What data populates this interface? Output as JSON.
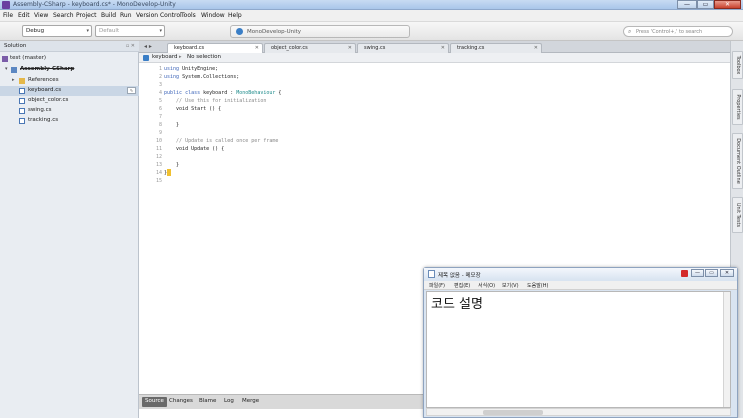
{
  "window": {
    "title": "Assembly-CSharp - keyboard.cs* - MonoDevelop-Unity",
    "minimize": "—",
    "maximize": "▭",
    "close": "✕"
  },
  "menu": [
    "File",
    "Edit",
    "View",
    "Search",
    "Project",
    "Build",
    "Run",
    "Version Control",
    "Tools",
    "Window",
    "Help"
  ],
  "toolbar": {
    "config": "Debug",
    "platform": "Default",
    "status": "MonoDevelop-Unity",
    "search_placeholder": "Press 'Control+,' to search"
  },
  "solution": {
    "title": "Solution",
    "controls": "▫ ✕",
    "items": [
      {
        "label": "test (master)"
      },
      {
        "label": "Assembly-CSharp"
      },
      {
        "label": "References"
      },
      {
        "label": "keyboard.cs",
        "badge": "✎"
      },
      {
        "label": "object_color.cs"
      },
      {
        "label": "swing.cs"
      },
      {
        "label": "tracking.cs"
      }
    ]
  },
  "tabs": {
    "nav": "◂ ▸",
    "items": [
      "keyboard.cs",
      "object_color.cs",
      "swing.cs",
      "tracking.cs"
    ],
    "close": "✕"
  },
  "path": {
    "file": "keyboard",
    "sep": "▸",
    "member": "No selection"
  },
  "code": {
    "line_numbers": [
      "1",
      "2",
      "3",
      "4",
      "5",
      "6",
      "7",
      "8",
      "9",
      "10",
      "11",
      "12",
      "13",
      "14",
      "15"
    ],
    "l1_kw": "using",
    "l1_rest": " UnityEngine;",
    "l2_kw": "using",
    "l2_rest": " System.Collections;",
    "l4_kw": "public class",
    "l4_name": " keyboard : ",
    "l4_type": "MonoBehaviour",
    "l4_end": " {",
    "l5": "    // Use this for initialization",
    "l6": "    void Start () {",
    "l8": "    }",
    "l10": "    // Update is called once per frame",
    "l11": "    void Update () {",
    "l13": "    }",
    "l14": "}"
  },
  "bottom_tabs": [
    "Source",
    "Changes",
    "Blame",
    "Log",
    "Merge"
  ],
  "dock": [
    "Toolbox",
    "Properties",
    "Document Outline",
    "Unit Tests"
  ],
  "notepad": {
    "title": "제목 없음 - 메모장",
    "menu": [
      "파일(F)",
      "편집(E)",
      "서식(O)",
      "보기(V)",
      "도움말(H)"
    ],
    "content": "코드 설명",
    "min": "—",
    "max": "▭",
    "close": "✕"
  }
}
